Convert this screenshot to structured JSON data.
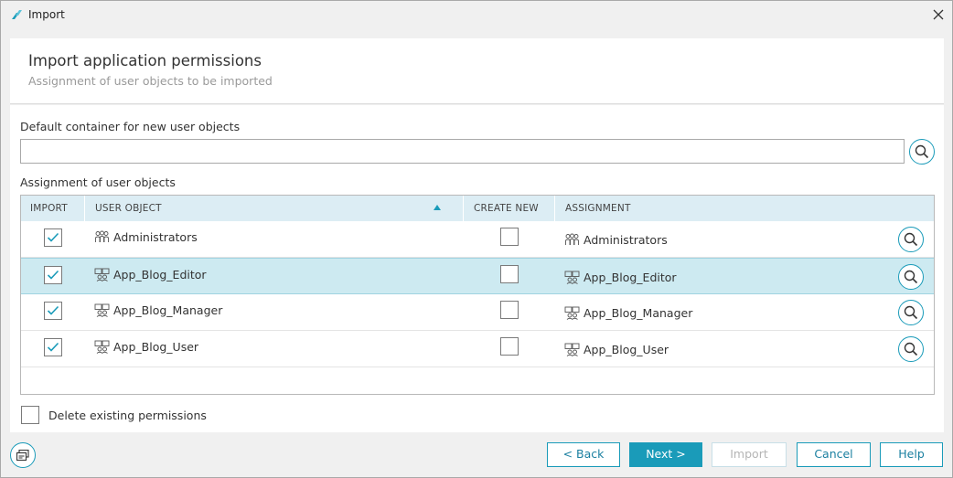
{
  "window": {
    "title": "Import"
  },
  "header": {
    "title": "Import application permissions",
    "subtitle": "Assignment of user objects to be imported"
  },
  "form": {
    "container_label": "Default container for new user objects",
    "container_value": "",
    "assignment_label": "Assignment of user objects",
    "delete_label": "Delete existing permissions",
    "delete_checked": false
  },
  "grid": {
    "columns": {
      "import": "IMPORT",
      "user_object": "USER OBJECT",
      "create_new": "CREATE NEW",
      "assignment": "ASSIGNMENT"
    },
    "sort": {
      "column": "user_object",
      "direction": "ascending"
    },
    "rows": [
      {
        "import": true,
        "user_object": "Administrators",
        "icon": "administrators-group-icon",
        "create_new": false,
        "assignment": "Administrators",
        "selected": false
      },
      {
        "import": true,
        "user_object": "App_Blog_Editor",
        "icon": "app-group-icon",
        "create_new": false,
        "assignment": "App_Blog_Editor",
        "selected": true
      },
      {
        "import": true,
        "user_object": "App_Blog_Manager",
        "icon": "app-group-icon",
        "create_new": false,
        "assignment": "App_Blog_Manager",
        "selected": false
      },
      {
        "import": true,
        "user_object": "App_Blog_User",
        "icon": "app-group-icon",
        "create_new": false,
        "assignment": "App_Blog_User",
        "selected": false
      }
    ]
  },
  "footer": {
    "back_label": "< Back",
    "next_label": "Next >",
    "import_label": "Import",
    "cancel_label": "Cancel",
    "help_label": "Help"
  },
  "colors": {
    "accent": "#1a9bb9",
    "header_bg": "#dcedf4",
    "selected_row": "#cdeaf1"
  }
}
